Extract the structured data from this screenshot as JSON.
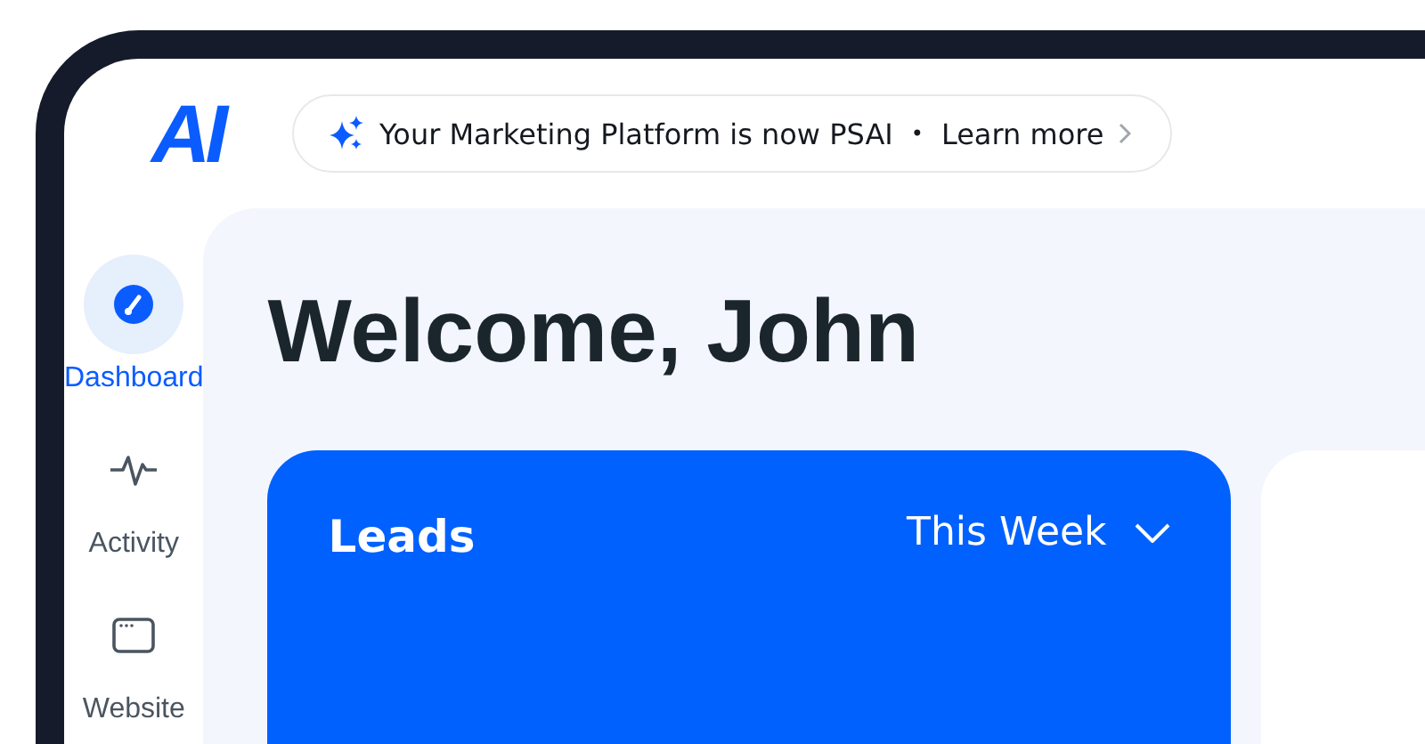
{
  "logo": "AI",
  "banner": {
    "text": "Your Marketing Platform is now PSAI",
    "separator": "•",
    "link": "Learn more"
  },
  "sidebar": {
    "items": [
      {
        "label": "Dashboard",
        "selected": true
      },
      {
        "label": "Activity",
        "selected": false
      },
      {
        "label": "Website",
        "selected": false
      }
    ]
  },
  "greeting": "Welcome, John",
  "leads_card": {
    "title": "Leads",
    "period": "This Week"
  }
}
